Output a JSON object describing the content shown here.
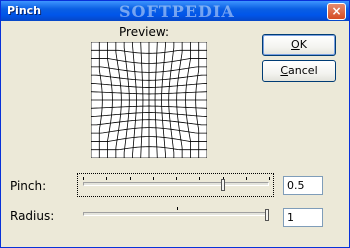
{
  "window": {
    "title": "Pinch",
    "watermark": "SOFTPEDIA",
    "close_glyph": "×"
  },
  "preview": {
    "label": "Preview:"
  },
  "buttons": {
    "ok_mnemonic": "O",
    "ok_rest": "K",
    "cancel_mnemonic": "C",
    "cancel_rest": "ancel"
  },
  "controls": {
    "pinch": {
      "label": "Pinch:",
      "value": "0.5",
      "slider_fraction": 0.75
    },
    "radius": {
      "label": "Radius:",
      "value": "1",
      "slider_fraction": 1.0
    }
  },
  "colors": {
    "titlebar": "#0A5FE3",
    "face": "#ECE9D8",
    "grid": "#000000"
  },
  "icons": {
    "close": "close-icon"
  }
}
